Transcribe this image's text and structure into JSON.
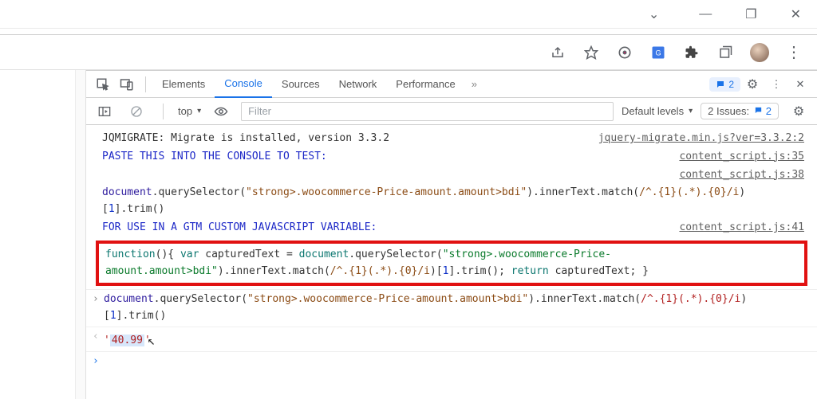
{
  "window": {
    "min": "—",
    "max": "❐",
    "close": "✕",
    "chevron": "⌄"
  },
  "toolbar": {
    "share": "share-icon",
    "star": "star-icon",
    "aim": "target-icon",
    "translate": "translate-icon",
    "ext": "puzzle-icon",
    "recent": "recent-tabs-icon",
    "menu": "⋮"
  },
  "devtools": {
    "tabs": {
      "elements": "Elements",
      "console": "Console",
      "sources": "Sources",
      "network": "Network",
      "performance": "Performance"
    },
    "more": "»",
    "msg_count": "2",
    "close": "✕"
  },
  "filterbar": {
    "context": "top",
    "filter_placeholder": "Filter",
    "levels": "Default levels",
    "issues_label": "2 Issues:",
    "issues_count": "2"
  },
  "logs": {
    "l1_text": "JQMIGRATE: Migrate is installed, version 3.3.2",
    "l1_link": "jquery-migrate.min.js?ver=3.3.2:2",
    "l2_text": "PASTE THIS INTO THE CONSOLE TO TEST:",
    "l2_link": "content_script.js:35",
    "l3_link": "content_script.js:38",
    "l4_a": "document",
    "l4_b": ".querySelector(",
    "l4_c": "\"strong>.woocommerce-Price-amount.amount>bdi\"",
    "l4_d": ").innerText.match(",
    "l4_e": "/^.{1}(.*).{0}/i",
    "l4_f": ")[",
    "l4_g": "1",
    "l4_h": "].trim()",
    "l5_text": "FOR USE IN A GTM CUSTOM JAVASCRIPT VARIABLE:",
    "l5_link": "content_script.js:41",
    "hl_a": "function",
    "hl_b": "(){ ",
    "hl_c": "var",
    "hl_d": " capturedText = ",
    "hl_e": "document",
    "hl_f": ".querySelector(",
    "hl_g": "\"strong>.woocommerce-Price-amount.amount>bdi\"",
    "hl_h": ").innerText.match(",
    "hl_i": "/^.{1}(.*).{0}/i",
    "hl_j": ")[",
    "hl_k": "1",
    "hl_l": "].trim(); ",
    "hl_m": "return",
    "hl_n": " capturedText; }",
    "pr_a": "document",
    "pr_b": ".querySelector(",
    "pr_c": "\"strong>.woocommerce-Price-amount.amount>bdi\"",
    "pr_d": ").innerText.match(",
    "pr_e": "/^.{1}(.*).{0}/i",
    "pr_f": ")[",
    "pr_g": "1",
    "pr_h": "].trim()",
    "out_q": "'",
    "out_val": "40.99"
  }
}
